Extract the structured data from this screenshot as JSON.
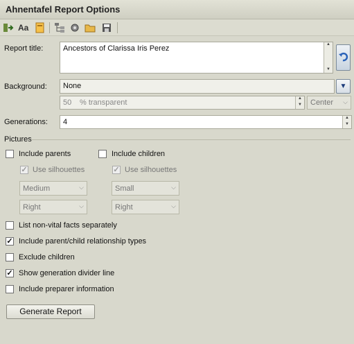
{
  "window": {
    "title": "Ahnentafel Report Options"
  },
  "toolbar": {
    "icons": [
      "add-person-icon",
      "font-icon",
      "document-icon",
      "tree-chart-icon",
      "settings-gear-icon",
      "folder-icon",
      "save-icon"
    ]
  },
  "report_title": {
    "label": "Report title:",
    "value": "Ancestors of Clarissa Iris Perez"
  },
  "background": {
    "label": "Background:",
    "value": "None",
    "transparency_value": "50",
    "transparency_unit": "% transparent",
    "position": "Center"
  },
  "generations": {
    "label": "Generations:",
    "value": "4"
  },
  "pictures": {
    "section_label": "Pictures",
    "include_parents": {
      "label": "Include parents",
      "checked": false
    },
    "include_children": {
      "label": "Include children",
      "checked": false
    },
    "parents_use_silhouettes": {
      "label": "Use silhouettes",
      "checked": true
    },
    "children_use_silhouettes": {
      "label": "Use silhouettes",
      "checked": true
    },
    "parents_size": "Medium",
    "children_size": "Small",
    "parents_align": "Right",
    "children_align": "Right"
  },
  "options": [
    {
      "label": "List non-vital facts separately",
      "checked": false
    },
    {
      "label": "Include parent/child relationship types",
      "checked": true
    },
    {
      "label": "Exclude children",
      "checked": false
    },
    {
      "label": "Show generation divider line",
      "checked": true
    },
    {
      "label": "Include preparer information",
      "checked": false
    }
  ],
  "generate_button": {
    "label": "Generate Report"
  }
}
